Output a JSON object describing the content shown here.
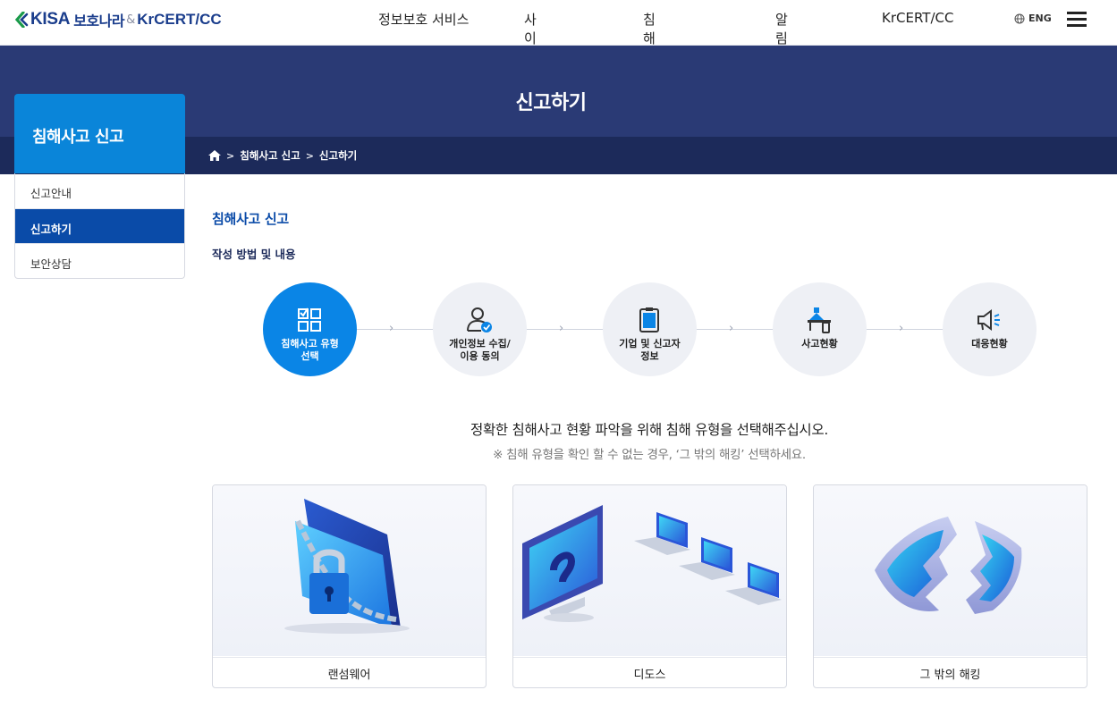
{
  "header": {
    "logo_kisa": "KISA",
    "logo_bohonara": "보호나라",
    "logo_amp": "&",
    "logo_kr": "Kr",
    "logo_cert": "CERT/CC",
    "nav": [
      "정보보호 서비스",
      "사이버위협",
      "침해사고 신고",
      "알림마당",
      "KrCERT/CC"
    ],
    "lang": "ENG"
  },
  "hero": {
    "title": "신고하기",
    "breadcrumb": [
      "침해사고 신고",
      "신고하기"
    ]
  },
  "sidebar": {
    "title": "침해사고 신고",
    "items": [
      {
        "label": "신고안내",
        "active": false
      },
      {
        "label": "신고하기",
        "active": true
      },
      {
        "label": "보안상담",
        "active": false
      }
    ]
  },
  "content": {
    "section_title": "침해사고 신고",
    "sub_title": "작성 방법 및 내용",
    "steps": [
      {
        "line1": "침해사고 유형",
        "line2": "선택",
        "icon": "checklist-icon",
        "active": true
      },
      {
        "line1": "개인정보 수집/",
        "line2": "이용 동의",
        "icon": "user-check-icon",
        "active": false
      },
      {
        "line1": "기업 및 신고자",
        "line2": "정보",
        "icon": "clipboard-icon",
        "active": false
      },
      {
        "line1": "사고현황",
        "line2": "",
        "icon": "lab-icon",
        "active": false
      },
      {
        "line1": "대응현황",
        "line2": "",
        "icon": "megaphone-icon",
        "active": false
      }
    ],
    "guide_main": "정확한 침해사고 현황 파악을 위해 침해 유형을 선택해주십시오.",
    "guide_note": "※ 침해 유형을 확인 할 수 없는 경우, ‘그 밖의 해킹’ 선택하세요.",
    "cards": [
      {
        "label": "랜섬웨어",
        "icon": "ransomware-folder-lock-icon"
      },
      {
        "label": "디도스",
        "icon": "ddos-computers-icon"
      },
      {
        "label": "그 밖의 해킹",
        "icon": "broken-shield-icon"
      }
    ]
  },
  "colors": {
    "brand_navy": "#1a3d8c",
    "hero_bg": "#2a3a75",
    "crumb_bg": "#1c2a5a",
    "accent_blue": "#0a85e6",
    "side_active": "#0a4ba8"
  }
}
